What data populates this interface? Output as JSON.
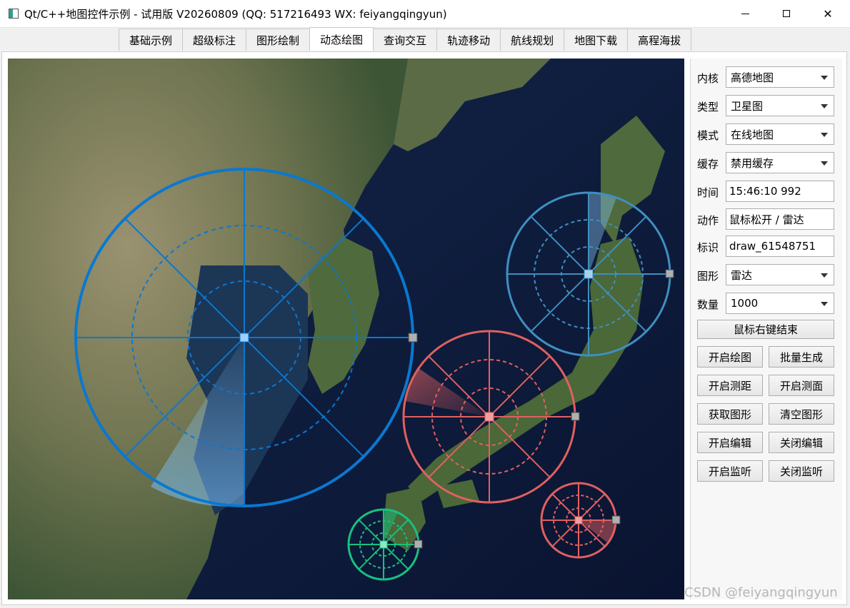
{
  "window": {
    "title": "Qt/C++地图控件示例 - 试用版 V20260809 (QQ: 517216493 WX: feiyangqingyun)",
    "close_glyph": "✕"
  },
  "tabs": [
    {
      "label": "基础示例"
    },
    {
      "label": "超级标注"
    },
    {
      "label": "图形绘制"
    },
    {
      "label": "动态绘图",
      "active": true
    },
    {
      "label": "查询交互"
    },
    {
      "label": "轨迹移动"
    },
    {
      "label": "航线规划"
    },
    {
      "label": "地图下载"
    },
    {
      "label": "高程海拔"
    }
  ],
  "panel": {
    "kernel": {
      "label": "内核",
      "value": "高德地图"
    },
    "type": {
      "label": "类型",
      "value": "卫星图"
    },
    "mode": {
      "label": "模式",
      "value": "在线地图"
    },
    "cache": {
      "label": "缓存",
      "value": "禁用缓存"
    },
    "time": {
      "label": "时间",
      "value": "15:46:10 992"
    },
    "action": {
      "label": "动作",
      "value": "鼠标松开 / 雷达"
    },
    "ident": {
      "label": "标识",
      "value": "draw_61548751"
    },
    "shape": {
      "label": "图形",
      "value": "雷达"
    },
    "count": {
      "label": "数量",
      "value": "1000"
    },
    "end_button": "鼠标右键结束",
    "buttons": [
      [
        "开启绘图",
        "批量生成"
      ],
      [
        "开启测距",
        "开启测面"
      ],
      [
        "获取图形",
        "清空图形"
      ],
      [
        "开启编辑",
        "关闭编辑"
      ],
      [
        "开启监听",
        "关闭监听"
      ]
    ]
  },
  "map": {
    "radar_colors": {
      "blue": "#0a78d0",
      "steel": "#3f8fc0",
      "red": "#e06060",
      "green": "#18c080"
    },
    "ocean_color": "#0d1a3a"
  },
  "watermark": "CSDN @feiyangqingyun"
}
